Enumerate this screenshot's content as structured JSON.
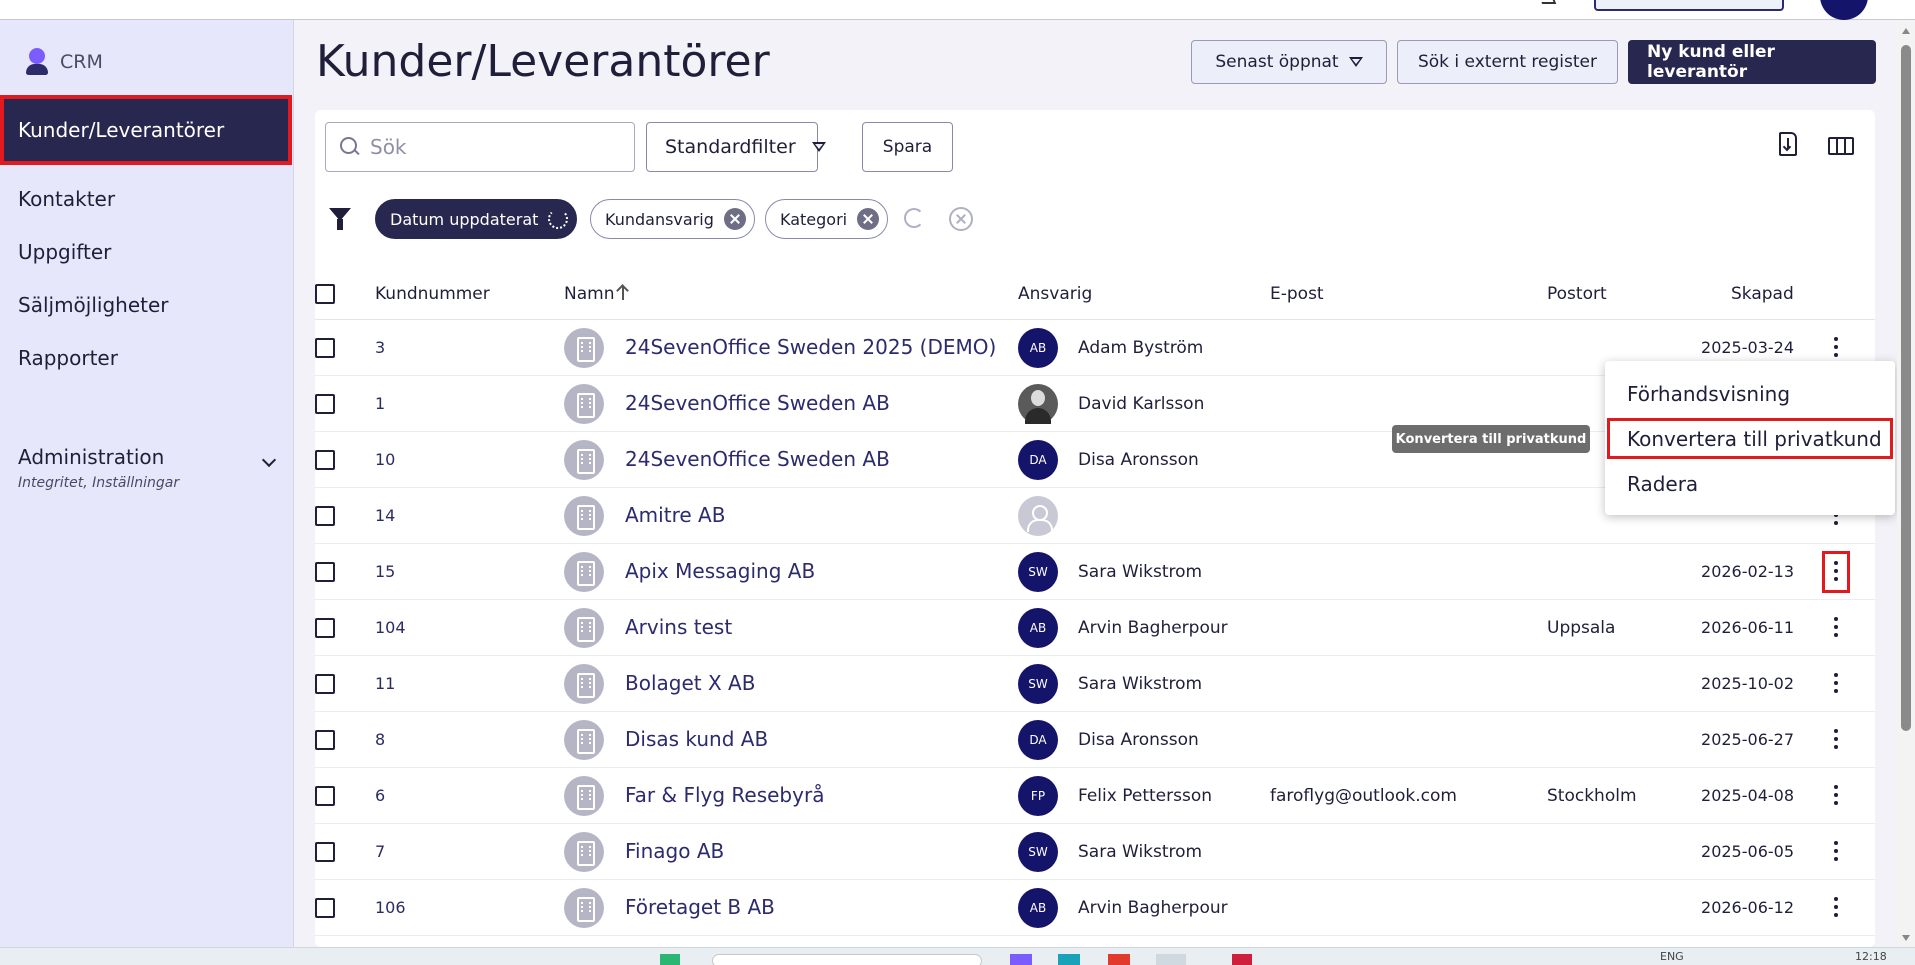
{
  "sidebar": {
    "app_label": "CRM",
    "items": [
      {
        "label": "Kunder/Leverantörer"
      },
      {
        "label": "Kontakter"
      },
      {
        "label": "Uppgifter"
      },
      {
        "label": "Säljmöjligheter"
      },
      {
        "label": "Rapporter"
      }
    ],
    "admin": {
      "label": "Administration",
      "sub": "Integritet, Inställningar"
    }
  },
  "header": {
    "title": "Kunder/Leverantörer",
    "recent_label": "Senast öppnat",
    "external_label": "Sök i externt register",
    "new_label": "Ny kund eller leverantör"
  },
  "toolbar": {
    "search_placeholder": "Sök",
    "filter_label": "Standardfilter",
    "save_label": "Spara"
  },
  "chips": [
    {
      "label": "Datum uppdaterat",
      "active": true
    },
    {
      "label": "Kundansvarig",
      "active": false
    },
    {
      "label": "Kategori",
      "active": false
    }
  ],
  "table": {
    "columns": {
      "number": "Kundnummer",
      "name": "Namn",
      "responsible": "Ansvarig",
      "email": "E-post",
      "city": "Postort",
      "created": "Skapad"
    },
    "rows": [
      {
        "number": "3",
        "name": "24SevenOffice Sweden 2025 (DEMO)",
        "initials": "AB",
        "avatar": "initials",
        "responsible": "Adam Byström",
        "email": "",
        "city": "",
        "created": "2025-03-24"
      },
      {
        "number": "1",
        "name": "24SevenOffice Sweden AB",
        "initials": "",
        "avatar": "photo",
        "responsible": "David Karlsson",
        "email": "",
        "city": "",
        "created": ""
      },
      {
        "number": "10",
        "name": "24SevenOffice Sweden AB",
        "initials": "DA",
        "avatar": "initials",
        "responsible": "Disa Aronsson",
        "email": "",
        "city": "",
        "created": ""
      },
      {
        "number": "14",
        "name": "Amitre AB",
        "initials": "",
        "avatar": "empty",
        "responsible": "",
        "email": "",
        "city": "",
        "created": ""
      },
      {
        "number": "15",
        "name": "Apix Messaging AB",
        "initials": "SW",
        "avatar": "initials",
        "responsible": "Sara Wikstrom",
        "email": "",
        "city": "",
        "created": "2026-02-13"
      },
      {
        "number": "104",
        "name": "Arvins test",
        "initials": "AB",
        "avatar": "initials",
        "responsible": "Arvin Bagherpour",
        "email": "",
        "city": "Uppsala",
        "created": "2026-06-11"
      },
      {
        "number": "11",
        "name": "Bolaget X AB",
        "initials": "SW",
        "avatar": "initials",
        "responsible": "Sara Wikstrom",
        "email": "",
        "city": "",
        "created": "2025-10-02"
      },
      {
        "number": "8",
        "name": "Disas kund AB",
        "initials": "DA",
        "avatar": "initials",
        "responsible": "Disa Aronsson",
        "email": "",
        "city": "",
        "created": "2025-06-27"
      },
      {
        "number": "6",
        "name": "Far & Flyg Resebyrå",
        "initials": "FP",
        "avatar": "initials",
        "responsible": "Felix Pettersson",
        "email": "faroflyg@outlook.com",
        "city": "Stockholm",
        "created": "2025-04-08"
      },
      {
        "number": "7",
        "name": "Finago AB",
        "initials": "SW",
        "avatar": "initials",
        "responsible": "Sara Wikstrom",
        "email": "",
        "city": "",
        "created": "2025-06-05"
      },
      {
        "number": "106",
        "name": "Företaget B AB",
        "initials": "AB",
        "avatar": "initials",
        "responsible": "Arvin Bagherpour",
        "email": "",
        "city": "",
        "created": "2026-06-12"
      }
    ]
  },
  "context_menu": {
    "items": [
      "Förhandsvisning",
      "Konvertera till privatkund",
      "Radera"
    ],
    "tooltip": "Konvertera till privatkund"
  },
  "colors": {
    "accent": "#27274f",
    "avatar": "#14146b",
    "highlight": "#e2191f"
  },
  "system": {
    "lang": "ENG",
    "clock": "12:18"
  }
}
